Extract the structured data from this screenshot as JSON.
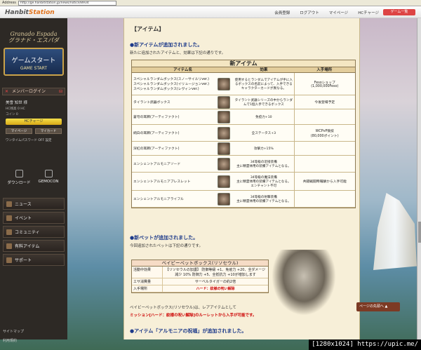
{
  "browser": {
    "address_label": "Address",
    "url": "http://ge.hanbitstation.jp/news/notice/8934"
  },
  "topnav": {
    "logo_main": "Hanbit",
    "logo_accent": "Station",
    "links": [
      "会員登録",
      "ログアウト",
      "マイページ",
      "HCチャージ"
    ],
    "game_button": "ゲーム一覧"
  },
  "sidebar": {
    "brand": "Granado Espada グラナド・エスパダ",
    "start_main": "ゲームスタート",
    "start_sub": "GAME START",
    "login_label": "メンバーログイン",
    "user": "美雪 知世 様",
    "hc": "HC残高 0 HC",
    "coin": "コイン 0",
    "hc_charge": "HCチャージ",
    "mypage": "マイページ",
    "mycard": "マイカード",
    "otp": "ワンタイムパスワード OFF 設定",
    "download": "ダウンロード",
    "gemocon": "GEMOCON",
    "menu": [
      "ニュース",
      "イベント",
      "コミュニティ",
      "有料アイテム",
      "サポート"
    ],
    "foot": [
      "サイトマップ",
      "利用規約"
    ]
  },
  "content": {
    "section_title": "【アイテム】",
    "new_items_title": "●新アイテムが追加されました。",
    "new_items_note": "新たに追加されたアイテムと、効果は下記の通りです。",
    "table_caption": "新アイテム",
    "headers": [
      "アイテム名",
      "効果",
      "入手場所"
    ],
    "items": [
      {
        "name": "スペシャルランダムボックス(スノーサイルリver.)\nスペシャルランダムボックス(イリュージョンver.)\nスペシャルランダムボックス(レヴィンver.)",
        "effect": "使用するとランダムでアイテムが手に入るボックスの名前によって、入手できるキャラクターカードが異なる。",
        "source": "Fesoショップ\n(1,000,000Feso)"
      },
      {
        "name": "タイラント武器ボックス",
        "effect": "タイラント武器シリーズの中からランダムで1個入手できるボックス",
        "source": "今後登場予定"
      },
      {
        "name": "蒼穹の耳飾(アーティファクト)",
        "effect": "免疫力+10",
        "source": ""
      },
      {
        "name": "純白の耳飾(アーティファクト)",
        "effect": "全ステータス+3",
        "source": "WCPvP競技\n(80,000ポイント)"
      },
      {
        "name": "深紅の耳飾(アーティファクト)",
        "effect": "攻撃力+15%",
        "source": ""
      },
      {
        "name": "エンシェントアルモニアソード",
        "effect": "34等級の近接装備\n主に精霊体用の装備アイテムとなる。",
        "source": ""
      },
      {
        "name": "エンシェントアルモニアブレスレット",
        "effect": "34等級の魔法装備\n主に精霊体用の装備アイテムとなる。\nエンチャント不可",
        "source": "共闘戦闘時報酬から入手可能"
      },
      {
        "name": "エンシェントアルモニアライフル",
        "effect": "34等級の射撃装備\n主に精霊体用の装備アイテムとなる。",
        "source": ""
      }
    ],
    "new_pet_title": "●新ペットが追加されました。",
    "new_pet_note": "今回追加されたペットは下記の通りです。",
    "pet_caption": "ベイビーペットボックス(リソセウル)",
    "pet_rows": [
      {
        "k": "活動中効果",
        "v": "【リソセウルの加護】 防御等級 +1、免疫力 +20、全ダメージ減少 10% 防御力 +5、全抵抗力 +10が増加します"
      },
      {
        "k": "エサ消費量",
        "v": "サーベルタイガーの約2倍"
      },
      {
        "k": "入手場所",
        "v": "ハード：紋様の呪い解除"
      }
    ],
    "pet_desc1": "ベイビーペットボックス(リソセウル)は、レアアイテムとして",
    "pet_desc2": "ミッション[ハード：紋様の呪い解除]のルーレットから入手が可能です。",
    "blessing_title": "●アイテム「アルモニアの祝福」が追加されました。",
    "page_top": "ページの先頭へ"
  },
  "credit": "[1280x1024] https://upic.me/"
}
